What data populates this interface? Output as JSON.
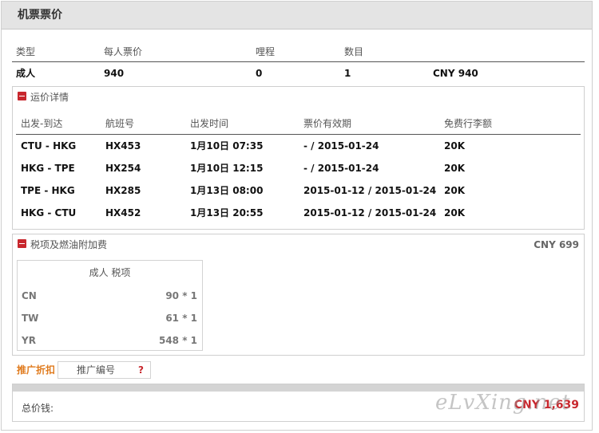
{
  "header": {
    "title": "机票票价"
  },
  "summary": {
    "headers": [
      "类型",
      "每人票价",
      "哩程",
      "数目"
    ],
    "row": {
      "type": "成人",
      "price": "940",
      "miles": "0",
      "count": "1",
      "total": "CNY 940"
    }
  },
  "fare_details": {
    "title": "运价详情",
    "headers": [
      "出发-到达",
      "航班号",
      "出发时间",
      "票价有效期",
      "免费行李额"
    ],
    "rows": [
      {
        "route": "CTU - HKG",
        "flight": "HX453",
        "time": "1月10日 07:35",
        "validity": "- / 2015-01-24",
        "baggage": "20K"
      },
      {
        "route": "HKG - TPE",
        "flight": "HX254",
        "time": "1月10日 12:15",
        "validity": "- / 2015-01-24",
        "baggage": "20K"
      },
      {
        "route": "TPE - HKG",
        "flight": "HX285",
        "time": "1月13日 08:00",
        "validity": "2015-01-12 / 2015-01-24",
        "baggage": "20K"
      },
      {
        "route": "HKG - CTU",
        "flight": "HX452",
        "time": "1月13日 20:55",
        "validity": "2015-01-12 / 2015-01-24",
        "baggage": "20K"
      }
    ]
  },
  "taxes": {
    "title": "税项及燃油附加费",
    "total": "CNY 699",
    "caption": "成人 税项",
    "rows": [
      {
        "code": "CN",
        "value": "90 * 1"
      },
      {
        "code": "TW",
        "value": "61 * 1"
      },
      {
        "code": "YR",
        "value": "548 * 1"
      }
    ]
  },
  "promo": {
    "label": "推广折扣",
    "placeholder": "推广编号",
    "help": "?"
  },
  "total": {
    "label": "总价钱:",
    "amount": "CNY 1,639"
  },
  "watermark": "eLvXing.net",
  "colors": {
    "accent_red": "#c8272d",
    "promo_orange": "#e07b1e",
    "header_gray": "#e4e4e4"
  },
  "icons": {
    "collapse": "minus-square-icon",
    "help": "question-mark-icon"
  }
}
